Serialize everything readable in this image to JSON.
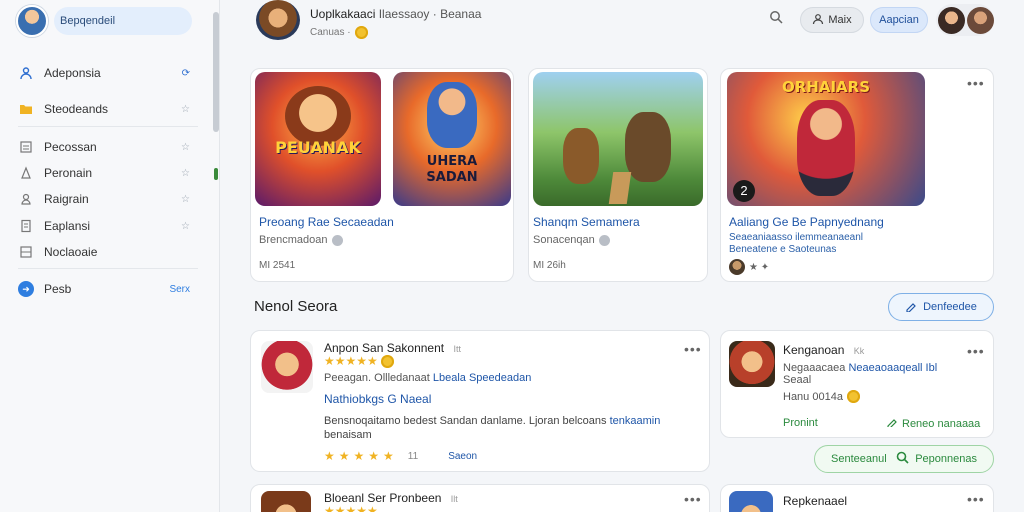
{
  "sidebar": {
    "search_placeholder": "Bepqendeil",
    "items": [
      {
        "label": "Adeponsia",
        "icon": "person-icon",
        "trail": "⟳"
      },
      {
        "label": "Steodeands",
        "icon": "folder-icon",
        "trail": "☆"
      },
      {
        "label": "Pecossan",
        "icon": "list-icon",
        "trail": "☆"
      },
      {
        "label": "Peronain",
        "icon": "person-icon",
        "trail": "☆"
      },
      {
        "label": "Raigrain",
        "icon": "user-icon",
        "trail": "☆"
      },
      {
        "label": "Eaplansi",
        "icon": "doc-icon",
        "trail": "☆"
      },
      {
        "label": "Noclaoaie",
        "icon": "grid-icon",
        "trail": ""
      },
      {
        "label": "Pesb",
        "icon": "info-icon",
        "trail": "Serx"
      }
    ]
  },
  "header": {
    "title": "Uoplkakaaci",
    "title_extra": "Ilaessaoy · Beanaa",
    "subtitle": "Canuas ·",
    "user_button": "Maix",
    "primary_button": "Aapcian"
  },
  "featured": [
    {
      "thumb_text": "PEUANAK",
      "title": "Preoang Rae Secaeadan",
      "sub": "Brencmadoan",
      "meta": "MI 2541"
    },
    {
      "thumb_text": "UHERA SADAN",
      "title": "",
      "sub": "",
      "meta": ""
    },
    {
      "thumb_text": "",
      "title": "Shanqm Semamera",
      "sub": "Sonacenqan",
      "meta": "MI 26ih"
    },
    {
      "thumb_text": "ORHAIARS",
      "thumb_badge": "2",
      "title": "Aaliang Ge Be Papnyednang",
      "sub": "Seaeaniaasso ilemmeanaeanl",
      "sub2": "Beneatene e Saoteunas",
      "meta": "★ ✦"
    }
  ],
  "section": {
    "title": "Nenol Seora",
    "button": "Denfeedee"
  },
  "list": [
    {
      "title": "Anpon San Sakonnent",
      "tag": "Itt",
      "stars_text": "★★★★★",
      "line1_a": "Peeagan. Ollledanaat",
      "line1_b": "Lbeala Speedeadan",
      "link": "Nathiobkgs G Naeal",
      "desc1": "Bensnoqaitamo bedest Sandan danlame. Ljoran belcoans",
      "desc1_link": "tenkaamin",
      "desc2": "benaisam",
      "rating_stars": "★★★★★",
      "rating_count": "11",
      "rating_extra": "Saeon"
    },
    {
      "title": "Kenganoan",
      "tag": "Kk",
      "line1_a": "Negaaacaea",
      "line1_b": "Neaeaoaaqeall Ibl",
      "line2": "Seaal",
      "line3": "Hanu 0014a",
      "action_left": "Pronint",
      "action_right": "Reneo nanaaaa",
      "btn_left": "Senteeanul",
      "btn_right": "Peponnenas"
    },
    {
      "title": "Bloeanl Ser Pronbeen",
      "tag": "Ilt"
    },
    {
      "title": "Repkenaael"
    }
  ]
}
